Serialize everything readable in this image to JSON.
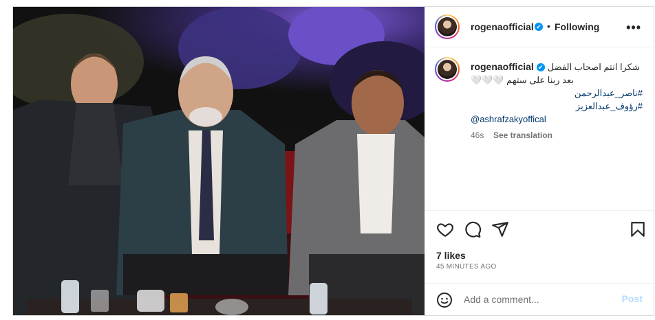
{
  "post": {
    "username": "rogenaofficial",
    "verified_badge": "✔",
    "separator": "•",
    "follow_status": "Following",
    "more_options": "•••"
  },
  "caption": {
    "username": "rogenaofficial",
    "line1": "شكرا انتم اصحاب الفضل",
    "line2": "بعد ربنا على ستهم 🤍🤍🤍",
    "hashtags": [
      "#ناصر_عبدالرحمن",
      "#رؤوف_عبدالعزيز"
    ],
    "mention": "@ashrafzakyoffical",
    "time": "46s",
    "translate": "See translation"
  },
  "engagement": {
    "likes": "7 likes",
    "posted_ago": "45 MINUTES AGO"
  },
  "comment": {
    "placeholder": "Add a comment...",
    "post_label": "Post"
  },
  "icons": {
    "like": "heart-icon",
    "comment": "comment-bubble-icon",
    "share": "paper-plane-icon",
    "save": "bookmark-icon",
    "emoji": "smiley-icon",
    "verified": "verified-badge-icon",
    "more": "ellipsis-icon"
  },
  "colors": {
    "link": "#00376b",
    "verified": "#0095f6",
    "post_button_disabled": "#b3dbff",
    "muted_text": "#737373",
    "border": "#dbdbdb"
  }
}
